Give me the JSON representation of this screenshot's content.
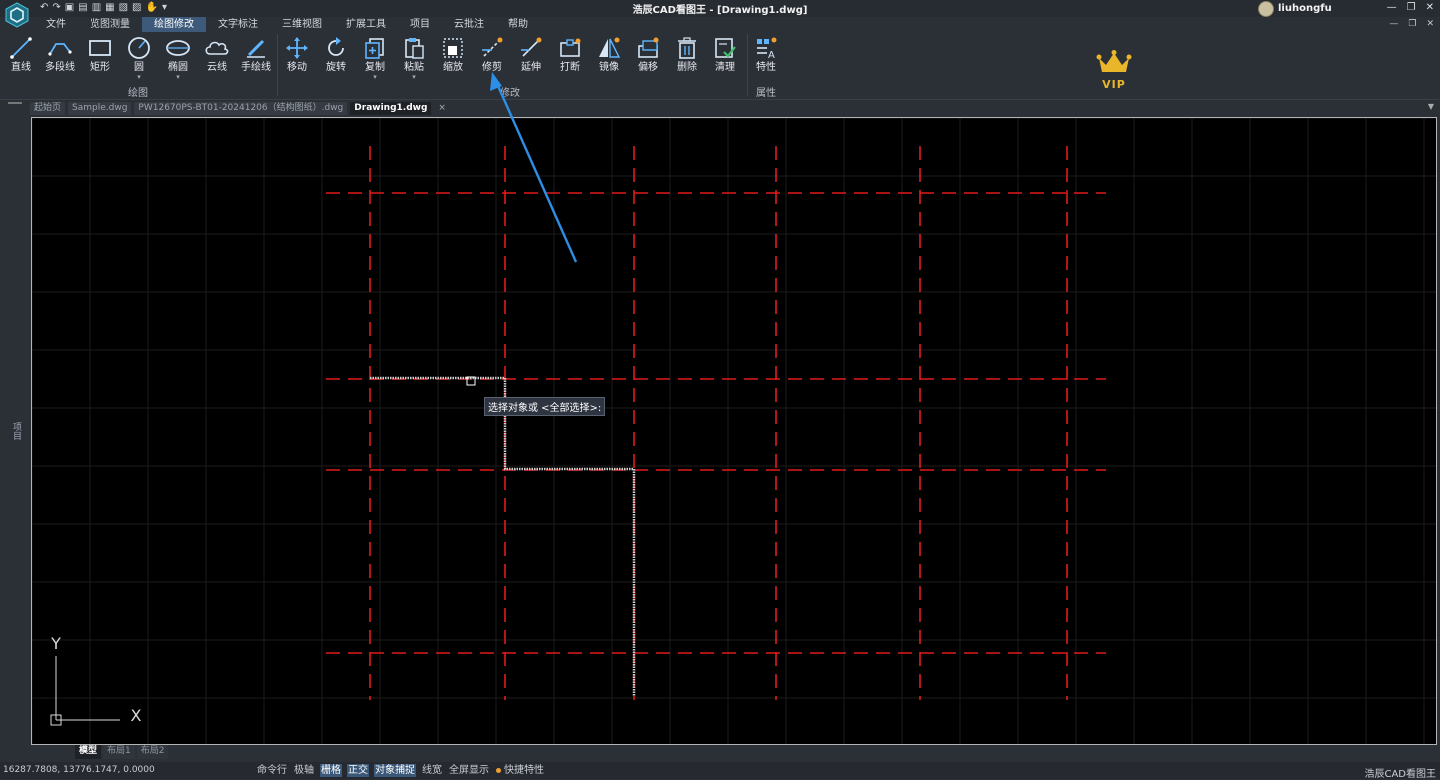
{
  "window": {
    "title": "浩辰CAD看图王 - [Drawing1.dwg]",
    "user": "liuhongfu",
    "controls": [
      "—",
      "❐",
      "✕"
    ],
    "doc_controls": [
      "—",
      "❐",
      "✕"
    ]
  },
  "quick_access": [
    "↶",
    "↷",
    "▣",
    "▤",
    "▥",
    "▦",
    "▧",
    "▨",
    "✋",
    "▾"
  ],
  "menu": [
    {
      "label": "文件"
    },
    {
      "label": "览图测量"
    },
    {
      "label": "绘图修改",
      "active": true
    },
    {
      "label": "文字标注"
    },
    {
      "label": "三维视图"
    },
    {
      "label": "扩展工具"
    },
    {
      "label": "项目"
    },
    {
      "label": "云批注"
    },
    {
      "label": "帮助"
    }
  ],
  "ribbon": {
    "draw_group_label": "绘图",
    "modify_group_label": "修改",
    "properties_group_label": "属性",
    "draw_tools": [
      {
        "label": "直线",
        "icon": "line-icon"
      },
      {
        "label": "多段线",
        "icon": "polyline-icon"
      },
      {
        "label": "矩形",
        "icon": "rectangle-icon"
      },
      {
        "label": "圆",
        "icon": "circle-icon",
        "dropdown": true
      },
      {
        "label": "椭圆",
        "icon": "ellipse-icon",
        "dropdown": true
      },
      {
        "label": "云线",
        "icon": "cloud-icon"
      },
      {
        "label": "手绘线",
        "icon": "pen-icon"
      }
    ],
    "modify_tools": [
      {
        "label": "移动",
        "icon": "move-icon"
      },
      {
        "label": "旋转",
        "icon": "rotate-icon"
      },
      {
        "label": "复制",
        "icon": "copy-icon",
        "dropdown": true
      },
      {
        "label": "粘贴",
        "icon": "paste-icon",
        "dropdown": true
      },
      {
        "label": "缩放",
        "icon": "scale-icon"
      },
      {
        "label": "修剪",
        "icon": "trim-icon"
      },
      {
        "label": "延伸",
        "icon": "extend-icon"
      },
      {
        "label": "打断",
        "icon": "break-icon"
      },
      {
        "label": "镜像",
        "icon": "mirror-icon"
      },
      {
        "label": "偏移",
        "icon": "offset-icon"
      },
      {
        "label": "删除",
        "icon": "delete-icon"
      },
      {
        "label": "清理",
        "icon": "purge-icon"
      }
    ],
    "properties_tool": {
      "label": "特性",
      "icon": "properties-icon"
    },
    "vip_label": "VIP"
  },
  "doc_tabs": [
    {
      "label": "起始页"
    },
    {
      "label": "Sample.dwg"
    },
    {
      "label": "PW12670PS-BT01-20241206（结构图纸）.dwg"
    },
    {
      "label": "Drawing1.dwg",
      "active": true
    }
  ],
  "doc_tab_close": "×",
  "left_panel_label": "项目",
  "canvas": {
    "prompt": "选择对象或 <全部选择>:",
    "ucs_x": "X",
    "ucs_y": "Y",
    "grid_color": "#1c1c1c",
    "axis_line_color": "#e01b1b",
    "selection_color": "#cfcfcf"
  },
  "layout_tabs": [
    {
      "label": "模型",
      "active": true
    },
    {
      "label": "布局1"
    },
    {
      "label": "布局2"
    }
  ],
  "status": {
    "coords": "16287.7808, 13776.1747, 0.0000",
    "toggles": [
      {
        "label": "命令行",
        "on": false
      },
      {
        "label": "极轴",
        "on": false
      },
      {
        "label": "栅格",
        "on": true
      },
      {
        "label": "正交",
        "on": true
      },
      {
        "label": "对象捕捉",
        "on": true
      },
      {
        "label": "线宽",
        "on": false
      },
      {
        "label": "全屏显示",
        "on": false
      }
    ],
    "quick_props": "快捷特性",
    "brand": "浩辰CAD看图王"
  },
  "accent_color": "#3d5a7a",
  "vip_color": "#e9b62b"
}
